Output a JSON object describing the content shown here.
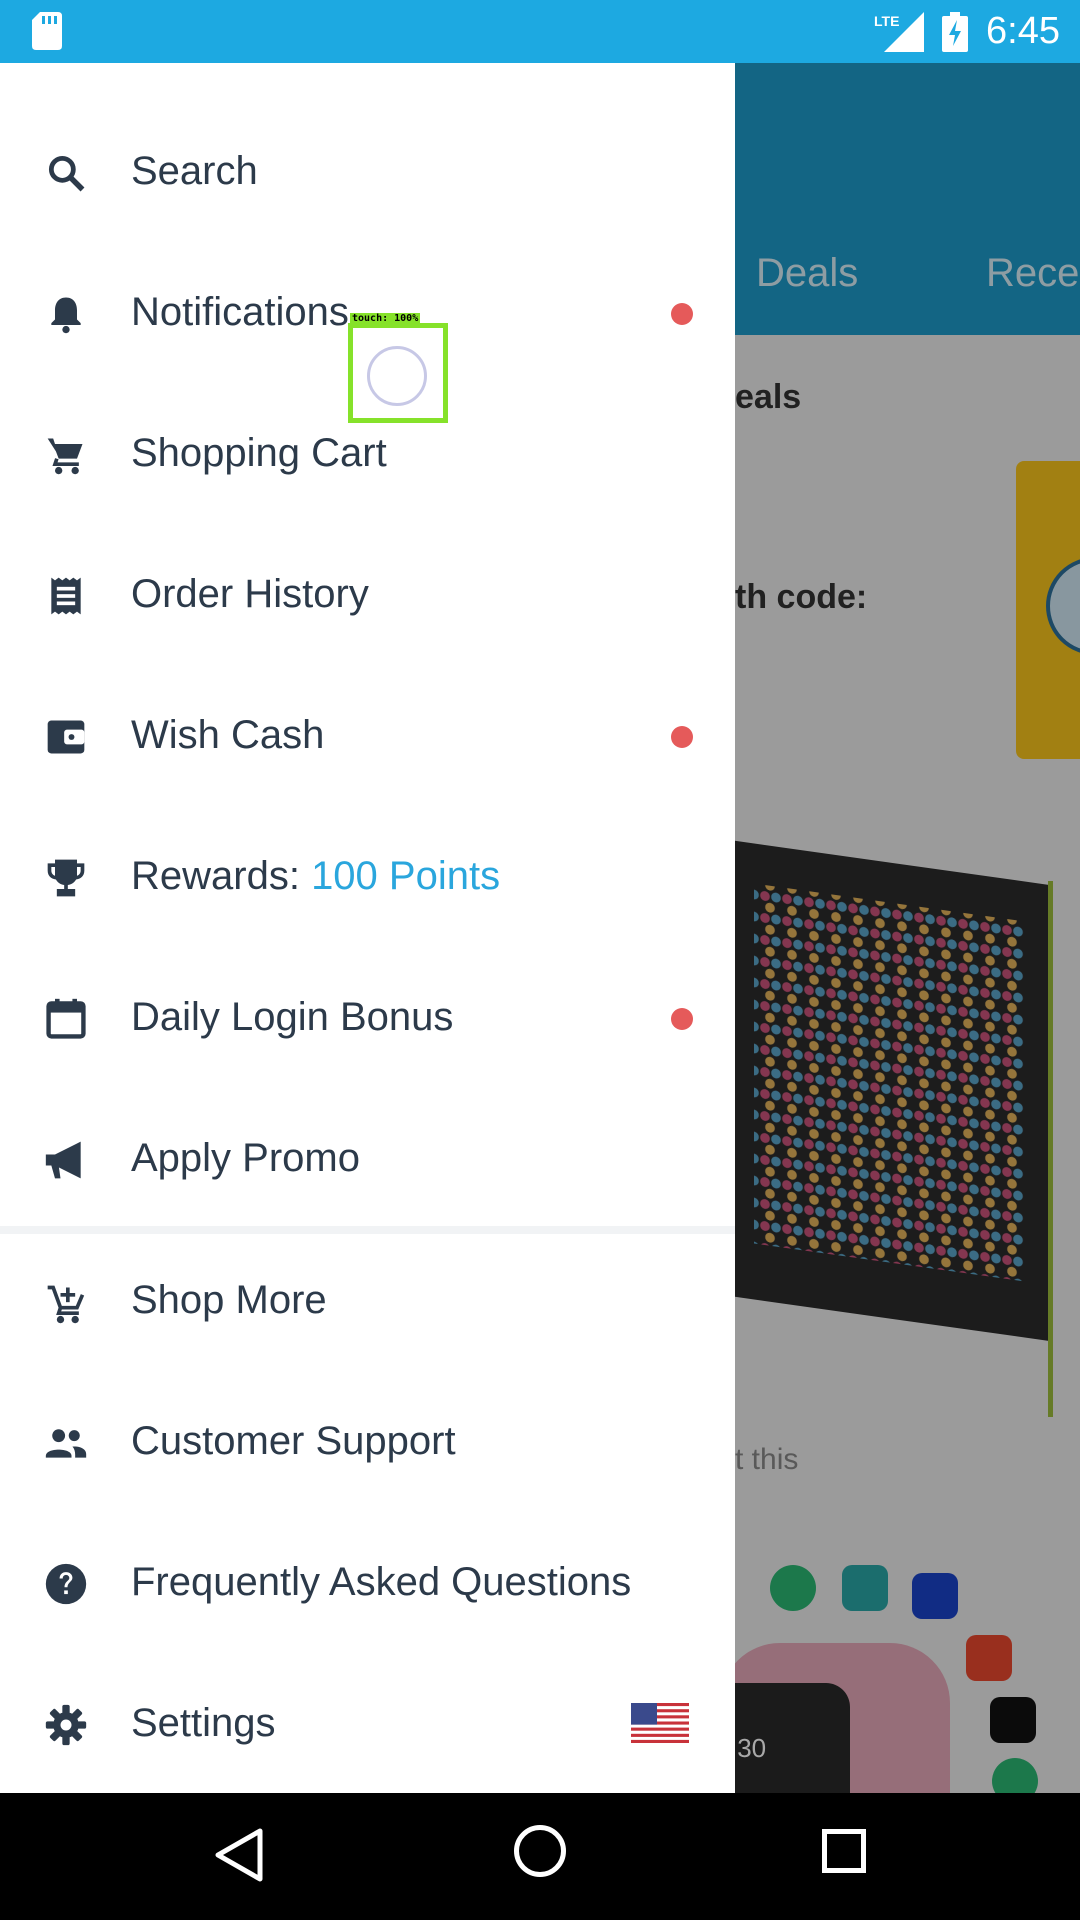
{
  "status_bar": {
    "time": "6:45",
    "network": "LTE",
    "icons": [
      "sd-card-icon",
      "lte-signal-icon",
      "battery-charging-icon"
    ]
  },
  "background_app": {
    "tabs": [
      "Deals",
      "Rece"
    ],
    "section_title_fragment": "eals",
    "promo_code_fragment": "th code:",
    "caption_fragment": "t this",
    "watch_time": ":30"
  },
  "drawer": {
    "items": [
      {
        "label": "Search",
        "icon": "search-icon",
        "badge": false
      },
      {
        "label": "Notifications",
        "icon": "bell-icon",
        "badge": true
      },
      {
        "label": "Shopping Cart",
        "icon": "cart-icon",
        "badge": false
      },
      {
        "label": "Order History",
        "icon": "receipt-icon",
        "badge": false
      },
      {
        "label": "Wish Cash",
        "icon": "wallet-icon",
        "badge": true
      },
      {
        "label": "Rewards: ",
        "value": "100 Points",
        "icon": "trophy-icon",
        "badge": false
      },
      {
        "label": "Daily Login Bonus",
        "icon": "calendar-icon",
        "badge": true
      },
      {
        "label": "Apply Promo",
        "icon": "megaphone-icon",
        "badge": false
      },
      {
        "label": "Shop More",
        "icon": "add-cart-icon",
        "badge": false
      },
      {
        "label": "Customer Support",
        "icon": "people-icon",
        "badge": false
      },
      {
        "label": "Frequently Asked Questions",
        "icon": "help-icon",
        "badge": false
      },
      {
        "label": "Settings",
        "icon": "gear-icon",
        "badge": false,
        "flag": "us-flag-icon"
      }
    ],
    "accent_color": "#2aa6dd",
    "badge_color": "#e55a5a"
  },
  "touch_overlay": {
    "label": "touch: 100%"
  },
  "nav_bar": {
    "buttons": [
      "back-icon",
      "home-icon",
      "recent-apps-icon"
    ]
  }
}
